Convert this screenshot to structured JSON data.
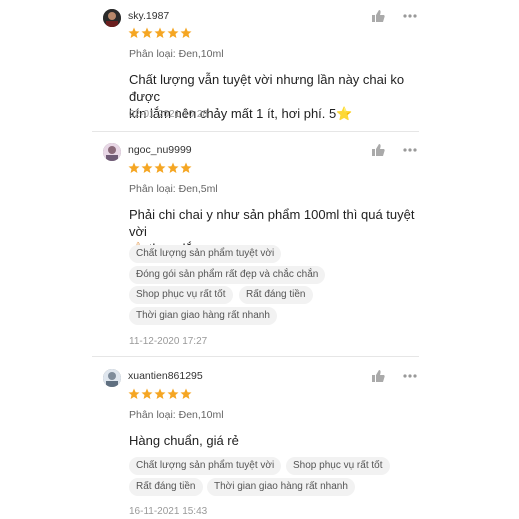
{
  "reviews": [
    {
      "username": "sky.1987",
      "rating": 5,
      "variant": "Phân loại: Đen,10ml",
      "comment_line1": "Chất lượng vẫn tuyệt vời nhưng lần này chai ko được",
      "comment_line2": "kín lắm nên chảy mất 1 ít, hơi phí. 5",
      "emoji": "⭐",
      "date": "02-01-2021 10:28",
      "tags": []
    },
    {
      "username": "ngoc_nu9999",
      "rating": 5,
      "variant": "Phân loại: Đen,5ml",
      "comment_line1": "Phải chi chai y như sản phẩm 100ml thì quá tuyệt vời",
      "emoji": "👍🏻",
      "comment_line2": "thơm lắm",
      "date": "11-12-2020 17:27",
      "tags": [
        "Chất lượng sản phẩm tuyệt vời",
        "Đóng gói sản phẩm rất đẹp và chắc chắn",
        "Shop phục vụ rất tốt",
        "Rất đáng tiền",
        "Thời gian giao hàng rất nhanh"
      ]
    },
    {
      "username": "xuantien861295",
      "rating": 5,
      "variant": "Phân loại: Đen,10ml",
      "comment_line1": "Hàng chuẩn, giá rẻ",
      "date": "16-11-2021 15:43",
      "tags": [
        "Chất lượng sản phẩm tuyệt vời",
        "Shop phục vụ rất tốt",
        "Rất đáng tiền",
        "Thời gian giao hàng rất nhanh"
      ]
    }
  ],
  "icons": {
    "like": "thumbs-up-icon",
    "more": "more-options-icon",
    "star": "star-icon"
  },
  "colors": {
    "star": "#f5a623",
    "tag_bg": "#f2f2f2",
    "date": "#999999"
  }
}
